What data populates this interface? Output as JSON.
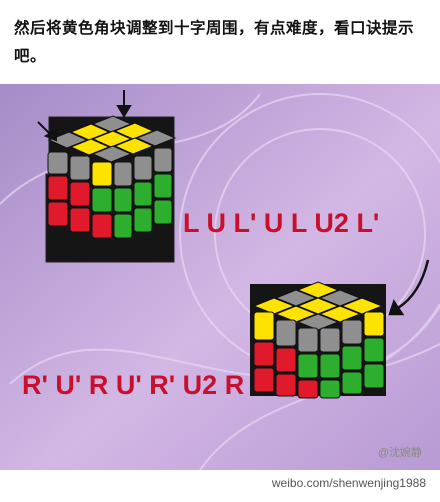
{
  "caption": "然后将黄色角块调整到十字周围，有点难度，看口诀提示吧。",
  "algorithm_1": "L U L' U L U2 L'",
  "algorithm_2": "R' U' R U' R' U2 R",
  "watermark": "weibo.com/shenwenjing1988",
  "weibo_handle": "@沈婉静",
  "colors": {
    "yellow": "#ffe300",
    "red": "#e0192b",
    "green": "#2eae2e",
    "gray": "#8f8f8f",
    "algo_text": "#c8102e"
  }
}
